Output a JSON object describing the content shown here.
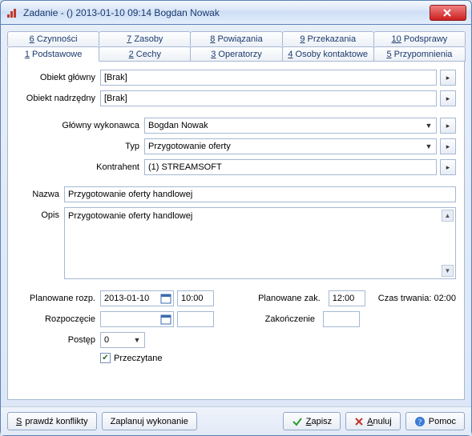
{
  "window": {
    "title": "Zadanie - ()  2013-01-10 09:14  Bogdan Nowak"
  },
  "tabs_row1": [
    {
      "num": "6",
      "label": "Czynności"
    },
    {
      "num": "7",
      "label": "Zasoby"
    },
    {
      "num": "8",
      "label": "Powiązania"
    },
    {
      "num": "9",
      "label": "Przekazania"
    },
    {
      "num": "10",
      "label": "Podsprawy"
    }
  ],
  "tabs_row2": [
    {
      "num": "1",
      "label": "Podstawowe"
    },
    {
      "num": "2",
      "label": "Cechy"
    },
    {
      "num": "3",
      "label": "Operatorzy"
    },
    {
      "num": "4",
      "label": "Osoby kontaktowe"
    },
    {
      "num": "5",
      "label": "Przypomnienia"
    }
  ],
  "form": {
    "obiekt_glowny": {
      "label": "Obiekt główny",
      "value": "[Brak]"
    },
    "obiekt_nadrzedny": {
      "label": "Obiekt nadrzędny",
      "value": "[Brak]"
    },
    "glowny_wykonawca": {
      "label": "Główny wykonawca",
      "value": "Bogdan Nowak"
    },
    "typ": {
      "label": "Typ",
      "value": "Przygotowanie oferty"
    },
    "kontrahent": {
      "label": "Kontrahent",
      "value": "(1) STREAMSOFT"
    },
    "nazwa": {
      "label": "Nazwa",
      "value": "Przygotowanie oferty handlowej"
    },
    "opis": {
      "label": "Opis",
      "value": "Przygotowanie oferty handlowej"
    },
    "planowane_rozp": {
      "label": "Planowane rozp.",
      "date": "2013-01-10",
      "time": "10:00"
    },
    "rozpoczecie": {
      "label": "Rozpoczęcie",
      "date": "",
      "time": ""
    },
    "planowane_zak": {
      "label": "Planowane zak.",
      "time": "12:00"
    },
    "zakonczenie": {
      "label": "Zakończenie",
      "time": ""
    },
    "czas_trwania": {
      "label": "Czas trwania:",
      "value": "02:00"
    },
    "postep": {
      "label": "Postęp",
      "value": "0"
    },
    "przeczytane": {
      "label": "Przeczytane",
      "checked": true
    }
  },
  "buttons": {
    "sprawdz_konflikty": "Sprawdź konflikty",
    "zaplanuj_wykonanie": "Zaplanuj wykonanie",
    "zapisz": "Zapisz",
    "anuluj": "Anuluj",
    "pomoc": "Pomoc"
  }
}
